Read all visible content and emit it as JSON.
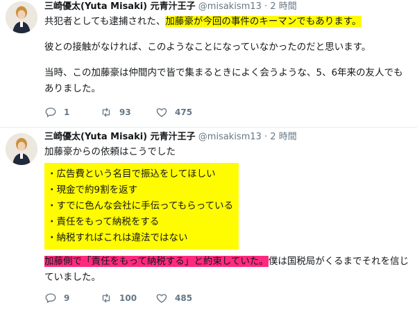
{
  "tweets": [
    {
      "author": {
        "display_name": "三崎優太(Yuta Misaki) 元青汁王子",
        "handle": "@misakism13",
        "separator": "·",
        "time": "2 時間"
      },
      "body": {
        "p1_pre": "共犯者としても逮捕された、",
        "p1_hl": "加藤豪が今回の事件のキーマンでもあります。",
        "p2": "彼との接触がなければ、このようなことになっていなかったのだと思います。",
        "p3": "当時、この加藤豪は仲間内で皆で集まるときによく会うような、5、6年来の友人でもありました。"
      },
      "actions": {
        "replies": "1",
        "retweets": "93",
        "likes": "475"
      }
    },
    {
      "author": {
        "display_name": "三崎優太(Yuta Misaki) 元青汁王子",
        "handle": "@misakism13",
        "separator": "·",
        "time": "2 時間"
      },
      "body": {
        "intro": "加藤豪からの依頼はこうでした",
        "list": [
          "・広告費という名目で振込をしてほしい",
          "・現金で約9割を返す",
          "・すでに色んな会社に手伝ってもらっている",
          "・責任をもって納税をする",
          "・納税すればこれは違法ではない"
        ],
        "closing_hl": "加藤側で「責任をもって納税する」と約束していた。",
        "closing_rest": "僕は国税局がくるまでそれを信じていました。"
      },
      "actions": {
        "replies": "9",
        "retweets": "100",
        "likes": "485"
      }
    }
  ],
  "icons": [
    "reply-icon",
    "retweet-icon",
    "like-icon"
  ],
  "colors": {
    "highlight_yellow": "#fffb00",
    "highlight_pink": "#ff2a7f",
    "meta_gray": "#657786"
  }
}
